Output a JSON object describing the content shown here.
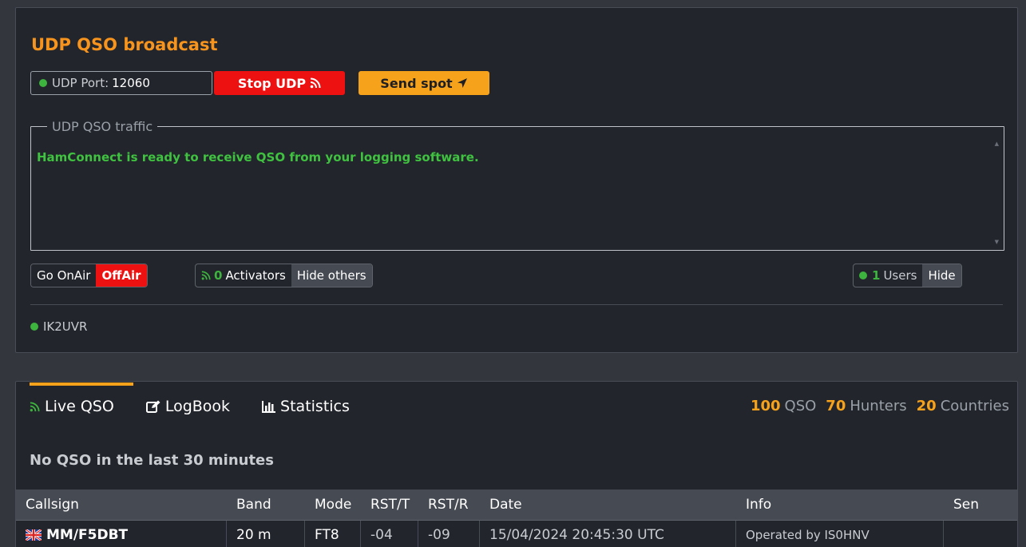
{
  "udp_panel": {
    "title": "UDP QSO broadcast",
    "port_label": "UDP Port:",
    "port_value": "12060",
    "stop_label": "Stop UDP",
    "spot_label": "Send spot",
    "traffic_legend": "UDP QSO traffic",
    "traffic_message": "HamConnect is ready to receive QSO from your logging software.",
    "go_onair": "Go OnAir",
    "offair": "OffAir",
    "activators_count": "0",
    "activators_label": "Activators",
    "hide_others": "Hide others",
    "users_count": "1",
    "users_label": "Users",
    "hide": "Hide",
    "online_user": "IK2UVR"
  },
  "qso_panel": {
    "tabs": [
      {
        "label": "Live QSO",
        "icon": "rss-icon"
      },
      {
        "label": "LogBook",
        "icon": "edit-icon"
      },
      {
        "label": "Statistics",
        "icon": "bar-chart-icon"
      }
    ],
    "stats": {
      "qso_count": "100",
      "qso_label": "QSO",
      "hunters_count": "70",
      "hunters_label": "Hunters",
      "countries_count": "20",
      "countries_label": "Countries"
    },
    "no_qso_message": "No QSO in the last 30 minutes",
    "table": {
      "headers": [
        "Callsign",
        "Band",
        "Mode",
        "RST/T",
        "RST/R",
        "Date",
        "Info",
        "Sen"
      ],
      "rows": [
        {
          "flag": "uk-flag-icon",
          "callsign": "MM/F5DBT",
          "band": "20 m",
          "mode": "FT8",
          "rst_t": "-04",
          "rst_r": "-09",
          "date": "15/04/2024 20:45:30 UTC",
          "info": "Operated by IS0HNV",
          "sent": ""
        }
      ]
    }
  },
  "colors": {
    "accent_orange": "#f7a21b",
    "stop_red": "#ee1111",
    "online_green": "#3db43d",
    "panel_bg": "#22252c",
    "page_bg": "#33363d"
  }
}
